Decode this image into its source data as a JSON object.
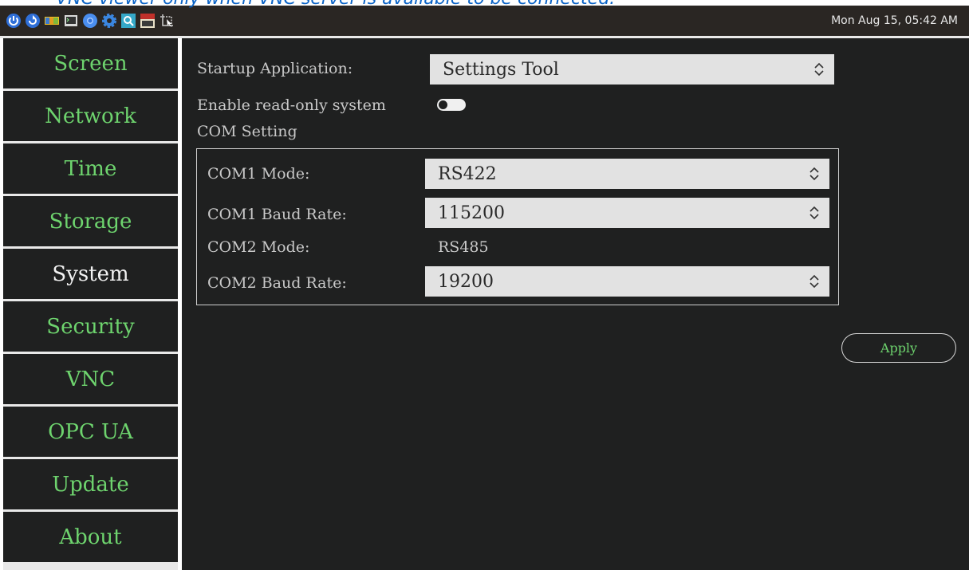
{
  "caption": "VNC viewer only when VNC server is available to be connected.",
  "taskbar": {
    "icons": [
      "power-icon",
      "restart-icon",
      "nxp-icon",
      "terminal-icon",
      "chromium-icon",
      "settings-gear-icon",
      "search-app-icon",
      "tightvnc-icon",
      "screenshot-tool-icon"
    ],
    "clock": "Mon Aug 15, 05:42 AM"
  },
  "sidebar": {
    "items": [
      {
        "label": "Screen",
        "active": false
      },
      {
        "label": "Network",
        "active": false
      },
      {
        "label": "Time",
        "active": false
      },
      {
        "label": "Storage",
        "active": false
      },
      {
        "label": "System",
        "active": true
      },
      {
        "label": "Security",
        "active": false
      },
      {
        "label": "VNC",
        "active": false
      },
      {
        "label": "OPC UA",
        "active": false
      },
      {
        "label": "Update",
        "active": false
      },
      {
        "label": "About",
        "active": false
      }
    ]
  },
  "main": {
    "startup_label": "Startup Application:",
    "startup_value": "Settings Tool",
    "readonly_label": "Enable read-only system",
    "readonly_enabled": false,
    "com_setting_label": "COM Setting",
    "com1_mode_label": "COM1 Mode:",
    "com1_mode_value": "RS422",
    "com1_baud_label": "COM1 Baud Rate:",
    "com1_baud_value": "115200",
    "com2_mode_label": "COM2 Mode:",
    "com2_mode_value": "RS485",
    "com2_baud_label": "COM2 Baud Rate:",
    "com2_baud_value": "19200",
    "apply_label": "Apply"
  },
  "colors": {
    "panel": "#1f2020",
    "accent_green": "#6ed46e",
    "caption_blue": "#0a63c7",
    "taskbar": "#2a2623"
  }
}
